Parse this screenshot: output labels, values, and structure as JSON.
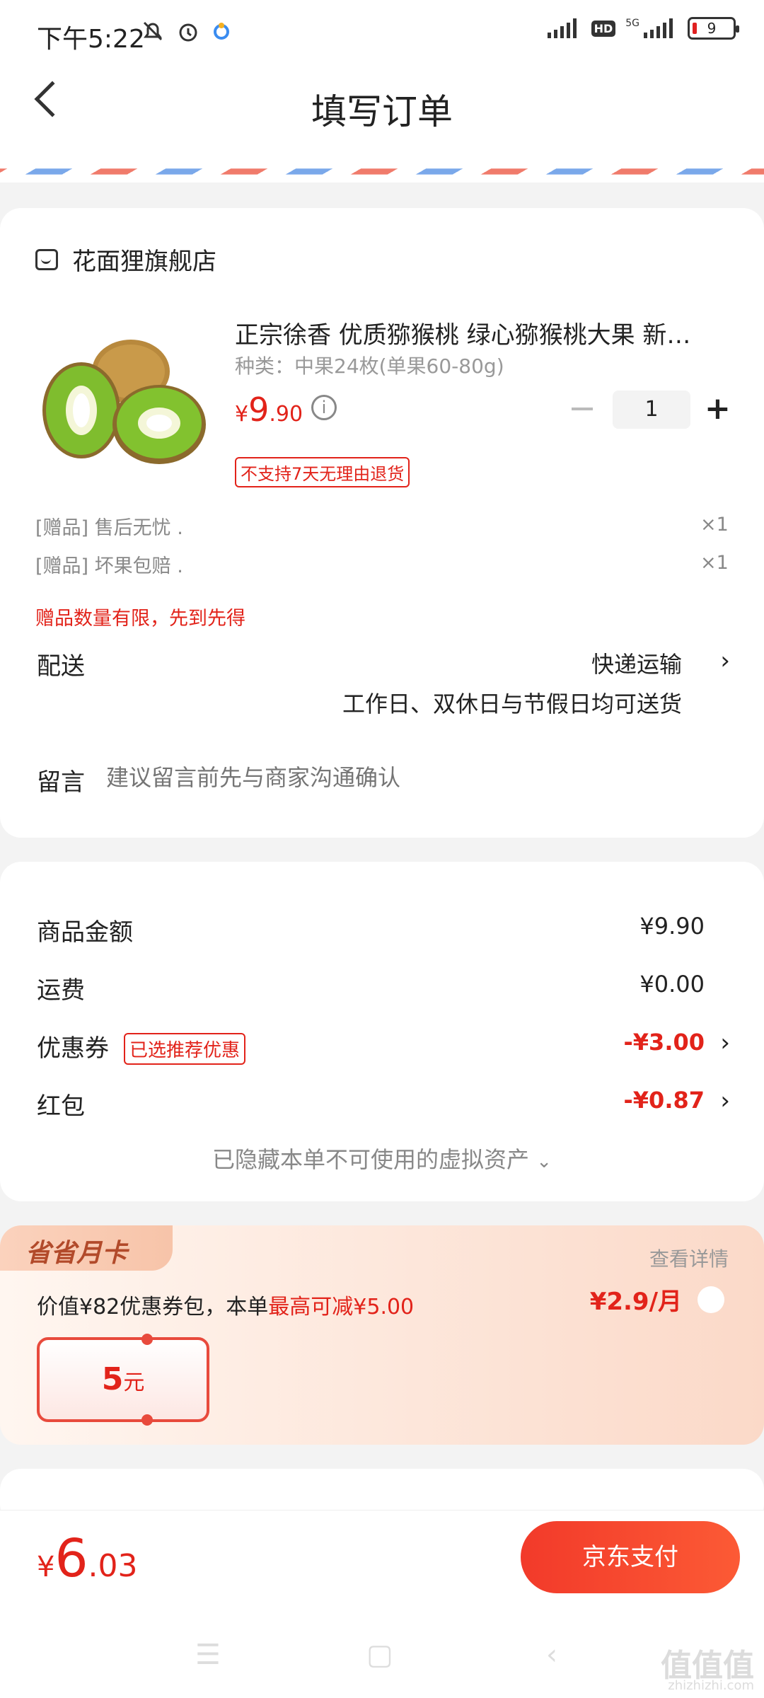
{
  "status_bar": {
    "time": "下午5:22",
    "network": "5G",
    "hd": "HD",
    "battery": "9"
  },
  "header": {
    "title": "填写订单"
  },
  "store": {
    "name": "花面狸旗舰店"
  },
  "product": {
    "name": "正宗徐香 优质猕猴桃 绿心猕猴桃大果 新…",
    "spec": "种类：中果24枚(单果60-80g)",
    "price_currency": "¥",
    "price_int": "9",
    "price_dec": ".90",
    "quantity": "1",
    "tag": "不支持7天无理由退货"
  },
  "gifts": [
    {
      "label": "[赠品]  售后无忧 .",
      "qty": "×1"
    },
    {
      "label": "[赠品]  坏果包赔 .",
      "qty": "×1"
    }
  ],
  "gift_limit": "赠品数量有限，先到先得",
  "delivery": {
    "label": "配送",
    "method": "快递运输",
    "note": "工作日、双休日与节假日均可送货"
  },
  "remark": {
    "label": "留言",
    "placeholder": "建议留言前先与商家沟通确认"
  },
  "summary": {
    "goods_label": "商品金额",
    "goods_value": "¥9.90",
    "shipping_label": "运费",
    "shipping_value": "¥0.00",
    "coupon_label": "优惠券",
    "coupon_tag": "已选推荐优惠",
    "coupon_value": "-¥3.00",
    "redpacket_label": "红包",
    "redpacket_value": "-¥0.87",
    "hidden_assets": "已隐藏本单不可使用的虚拟资产"
  },
  "monthly_card": {
    "badge": "省省月卡",
    "detail_link": "查看详情",
    "desc_prefix": "价值¥82优惠券包，本单",
    "desc_highlight": "最高可减¥5.00",
    "price": "¥2.9/月",
    "coupon_amount": "5",
    "coupon_unit": "元"
  },
  "bottom": {
    "currency": "¥",
    "total_int": "6",
    "total_dec": ".03",
    "pay_label": "京东支付"
  },
  "watermark": {
    "text": "值值值",
    "sub": "zhizhizhi.com"
  }
}
